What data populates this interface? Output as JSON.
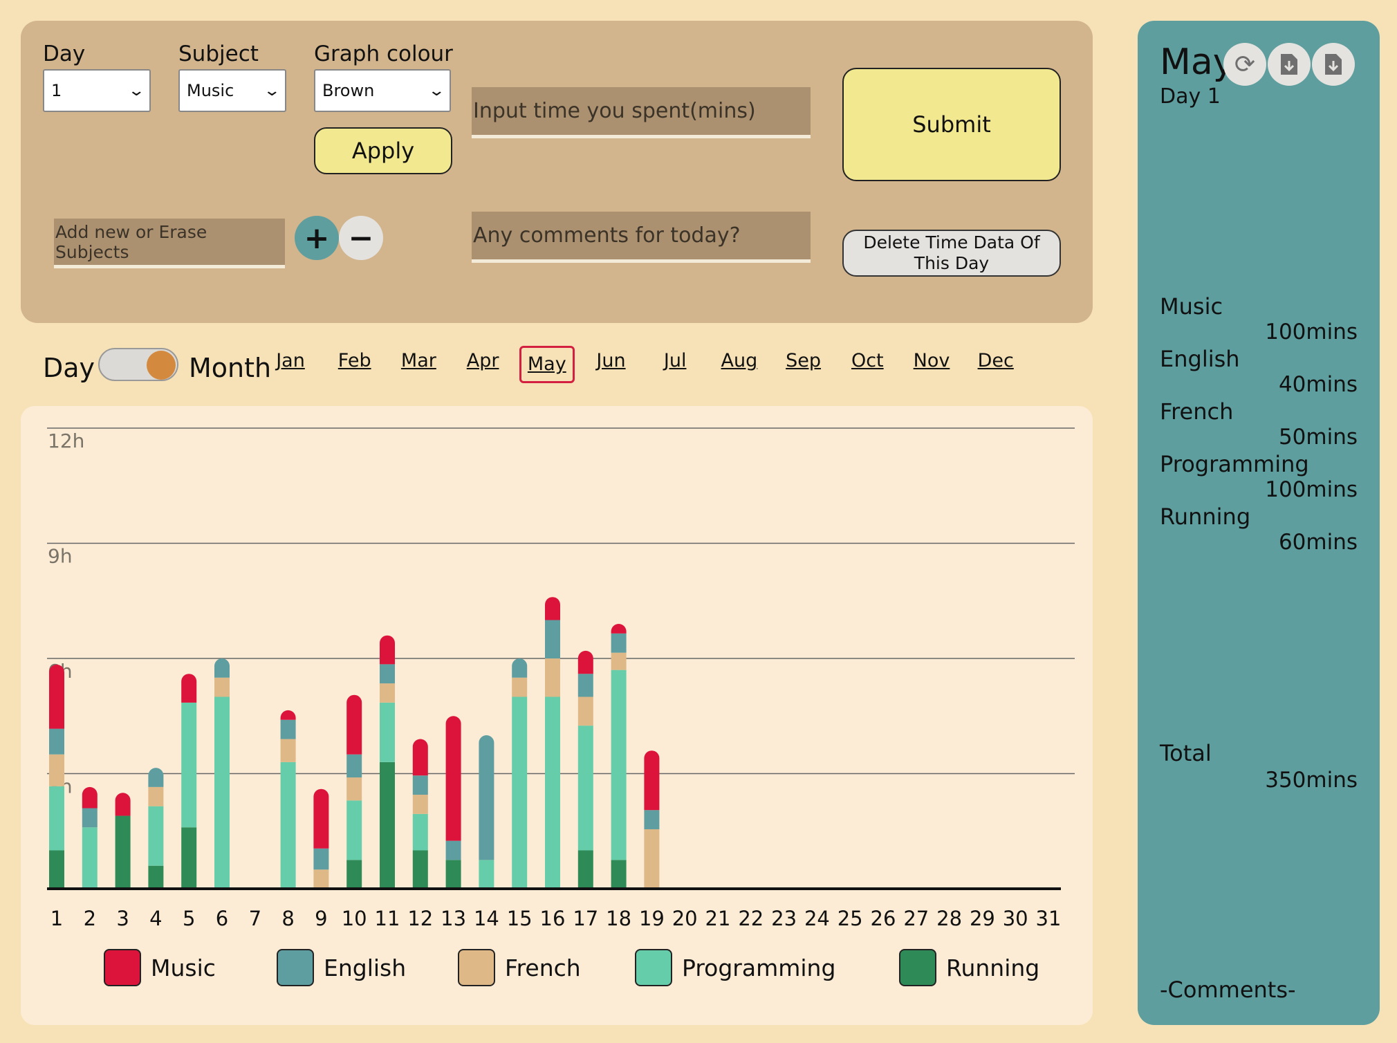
{
  "form": {
    "day_label": "Day",
    "day_value": "1",
    "subject_label": "Subject",
    "subject_value": "Music",
    "graph_colour_label": "Graph colour",
    "graph_colour_value": "Brown",
    "apply_label": "Apply",
    "time_placeholder": "Input time you spent(mins)",
    "comments_placeholder": "Any comments for today?",
    "subjects_placeholder": "Add new or Erase Subjects",
    "submit_label": "Submit",
    "delete_label": "Delete Time Data Of This Day",
    "add_symbol": "+",
    "remove_symbol": "−"
  },
  "view_toggle": {
    "left_label": "Day",
    "right_label": "Month",
    "selected": "Month"
  },
  "months": [
    "Jan",
    "Feb",
    "Mar",
    "Apr",
    "May",
    "Jun",
    "Jul",
    "Aug",
    "Sep",
    "Oct",
    "Nov",
    "Dec"
  ],
  "active_month": "May",
  "legend": [
    {
      "name": "Music",
      "color": "#dc143c"
    },
    {
      "name": "English",
      "color": "#5f9ea0"
    },
    {
      "name": "French",
      "color": "#deb887"
    },
    {
      "name": "Programming",
      "color": "#66cdaa"
    },
    {
      "name": "Running",
      "color": "#2e8b57"
    }
  ],
  "chart_data": {
    "type": "bar",
    "stacked": true,
    "title": "",
    "xlabel": "",
    "ylabel": "",
    "y_unit": "hours",
    "ylim": [
      0,
      12
    ],
    "ytick_labels": [
      "3h",
      "6h",
      "9h",
      "12h"
    ],
    "grid": true,
    "legend_position": "bottom",
    "categories": [
      "1",
      "2",
      "3",
      "4",
      "5",
      "6",
      "7",
      "8",
      "9",
      "10",
      "11",
      "12",
      "13",
      "14",
      "15",
      "16",
      "17",
      "18",
      "19",
      "20",
      "21",
      "22",
      "23",
      "24",
      "25",
      "26",
      "27",
      "28",
      "29",
      "30",
      "31"
    ],
    "series": [
      {
        "name": "Running",
        "color": "#2e8b57",
        "values": [
          1.0,
          0,
          1.9,
          0.6,
          1.6,
          0,
          0,
          0,
          0,
          0.75,
          3.3,
          1.0,
          0.75,
          0,
          0,
          0,
          1.0,
          0.75,
          0,
          0,
          0,
          0,
          0,
          0,
          0,
          0,
          0,
          0,
          0,
          0,
          0
        ]
      },
      {
        "name": "Programming",
        "color": "#66cdaa",
        "values": [
          1.67,
          1.6,
          0,
          1.55,
          3.25,
          5.0,
          0,
          3.3,
          0,
          1.55,
          1.55,
          0.95,
          0,
          0.75,
          5.0,
          5.0,
          3.25,
          4.95,
          0,
          0,
          0,
          0,
          0,
          0,
          0,
          0,
          0,
          0,
          0,
          0,
          0
        ]
      },
      {
        "name": "French",
        "color": "#deb887",
        "values": [
          0.83,
          0,
          0,
          0.5,
          0,
          0.5,
          0,
          0.6,
          0.5,
          0.6,
          0.5,
          0.5,
          0,
          0,
          0.5,
          1.0,
          0.75,
          0.45,
          1.55,
          0,
          0,
          0,
          0,
          0,
          0,
          0,
          0,
          0,
          0,
          0,
          0
        ]
      },
      {
        "name": "English",
        "color": "#5f9ea0",
        "values": [
          0.67,
          0.5,
          0,
          0.5,
          0,
          0.5,
          0,
          0.5,
          0.55,
          0.6,
          0.5,
          0.5,
          0.5,
          3.25,
          0.5,
          1.0,
          0.6,
          0.5,
          0.5,
          0,
          0,
          0,
          0,
          0,
          0,
          0,
          0,
          0,
          0,
          0,
          0
        ]
      },
      {
        "name": "Music",
        "color": "#dc143c",
        "values": [
          1.67,
          0.55,
          0.6,
          0,
          0.75,
          0,
          0,
          0.25,
          1.55,
          1.55,
          0.75,
          0.95,
          3.25,
          0,
          0,
          0.6,
          0.6,
          0.25,
          1.55,
          0,
          0,
          0,
          0,
          0,
          0,
          0,
          0,
          0,
          0,
          0,
          0
        ]
      }
    ]
  },
  "side": {
    "month": "May",
    "day": "Day 1",
    "icons": [
      "refresh-icon",
      "download-file-icon",
      "download-file-icon-2"
    ],
    "subjects": [
      {
        "name": "Music",
        "mins": "100mins"
      },
      {
        "name": "English",
        "mins": "40mins"
      },
      {
        "name": "French",
        "mins": "50mins"
      },
      {
        "name": "Programming",
        "mins": "100mins"
      },
      {
        "name": "Running",
        "mins": "60mins"
      }
    ],
    "total_label": "Total",
    "total_value": "350mins",
    "comments_label": "-Comments-"
  }
}
